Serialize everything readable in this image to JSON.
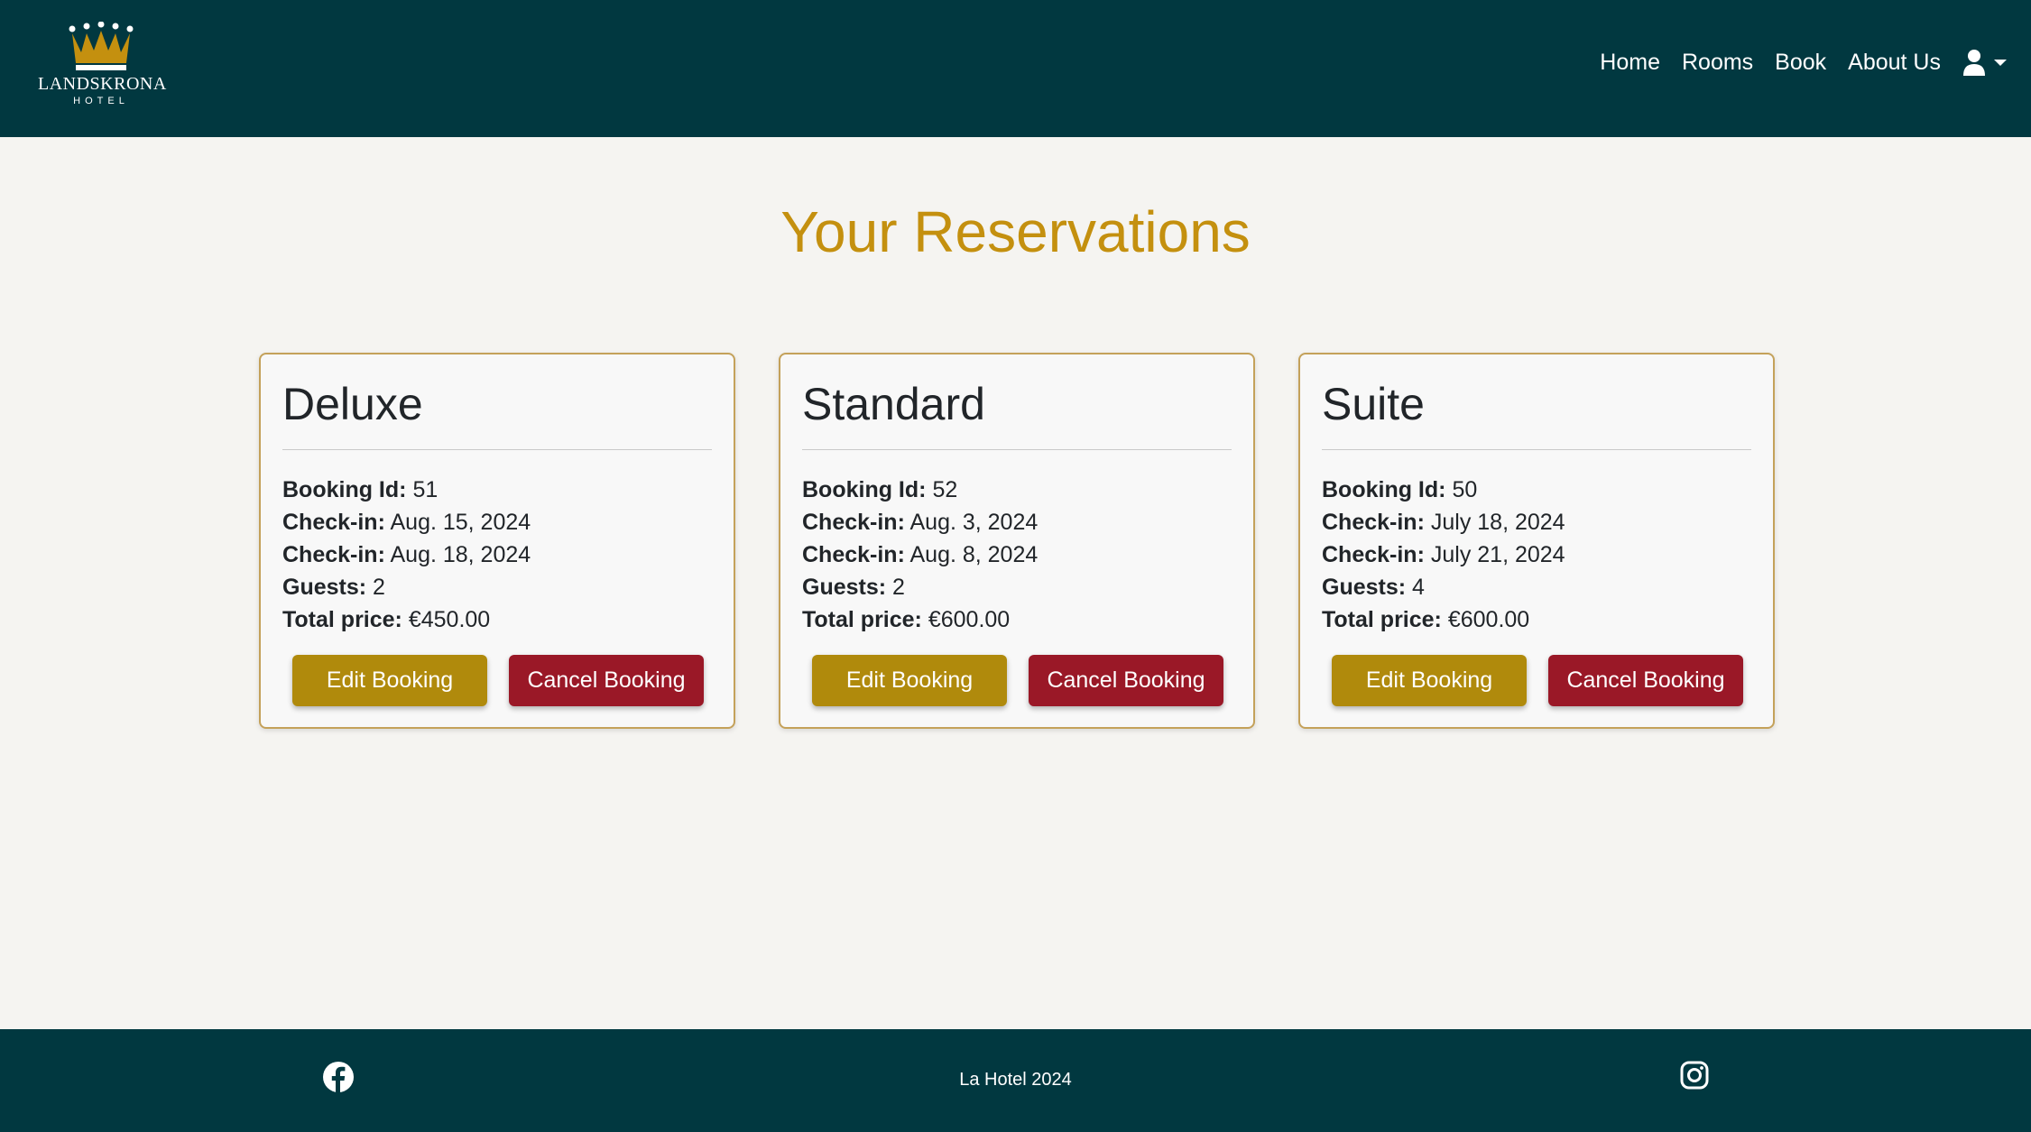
{
  "brand": {
    "name": "LANDSKRONA",
    "subtitle": "HOTEL"
  },
  "nav": {
    "items": [
      "Home",
      "Rooms",
      "Book",
      "About Us"
    ],
    "user_icon": "user-icon"
  },
  "colors": {
    "navbar_bg": "#013840",
    "page_bg": "#f5f4f1",
    "title": "#c4900f",
    "edit_button": "#b08a0c",
    "cancel_button": "#9a1827",
    "card_border": "#c4a15a"
  },
  "main": {
    "title": "Your Reservations",
    "labels": {
      "booking_id": "Booking Id:",
      "check_in": "Check-in:",
      "check_out": "Check-in:",
      "guests": "Guests:",
      "total_price": "Total price:"
    },
    "cards": [
      {
        "room": "Deluxe",
        "booking_id": "51",
        "check_in": "Aug. 15, 2024",
        "check_out": "Aug. 18, 2024",
        "guests": "2",
        "total_price": "€450.00",
        "edit_label": "Edit Booking",
        "cancel_label": "Cancel Booking"
      },
      {
        "room": "Standard",
        "booking_id": "52",
        "check_in": "Aug. 3, 2024",
        "check_out": "Aug. 8, 2024",
        "guests": "2",
        "total_price": "€600.00",
        "edit_label": "Edit Booking",
        "cancel_label": "Cancel Booking"
      },
      {
        "room": "Suite",
        "booking_id": "50",
        "check_in": "July 18, 2024",
        "check_out": "July 21, 2024",
        "guests": "4",
        "total_price": "€600.00",
        "edit_label": "Edit Booking",
        "cancel_label": "Cancel Booking"
      }
    ]
  },
  "footer": {
    "text": "La Hotel 2024",
    "icons": [
      "facebook-icon",
      "instagram-icon"
    ]
  }
}
